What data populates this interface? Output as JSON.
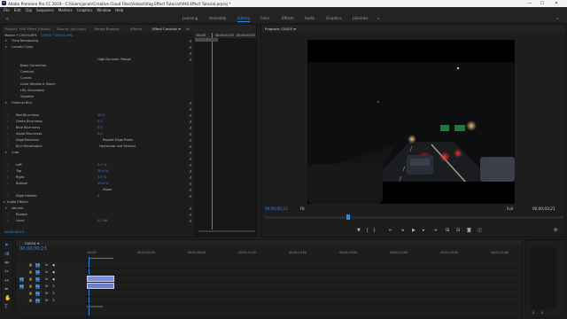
{
  "app": {
    "title": "Adobe Premiere Pro CC 2019 - C:\\Users\\jonah\\Creative Cloud Files\\Videos\\Vlog Effect Tutorial\\VHS Effect Tutorial.prproj *",
    "logo_text": "Pr"
  },
  "window_controls": {
    "minimize": "—",
    "maximize": "☐",
    "close": "✕"
  },
  "menu": [
    "File",
    "Edit",
    "Clip",
    "Sequence",
    "Markers",
    "Graphics",
    "Window",
    "Help"
  ],
  "workspaces": [
    {
      "label": "Learning",
      "active": false
    },
    {
      "label": "Assembly",
      "active": false
    },
    {
      "label": "Editing",
      "active": true
    },
    {
      "label": "Color",
      "active": false
    },
    {
      "label": "Effects",
      "active": false
    },
    {
      "label": "Audio",
      "active": false
    },
    {
      "label": "Graphics",
      "active": false
    },
    {
      "label": "Libraries",
      "active": false
    }
  ],
  "left_panel": {
    "tabs": [
      "Project: VHS Effect Tutorial",
      "Source: (no clips)",
      "Media Browser",
      "Effects",
      "Effect Controls ≡",
      "≫"
    ],
    "master_label": "Master * C0024.MP4",
    "clip_label": "C0024 * C0024.MP4",
    "time_ruler": [
      ":00:00",
      "00:00:01:00",
      "00:00:02:00"
    ],
    "hdr_label": "High Dynamic Range",
    "edge_behavior_option": "Repeat Edge Pixels",
    "blur_dimensions_option": "Horizontal and Vertical",
    "zoom_label": "Zoom",
    "current_time": "00:00:00:23",
    "rows": [
      {
        "label": "Time Remapping",
        "value": "",
        "indent": 1
      },
      {
        "label": "Lumetri Color",
        "value": "",
        "indent": 1
      },
      {
        "label": "",
        "value": "",
        "indent": 2
      },
      {
        "label": "",
        "value": "",
        "indent": 2
      },
      {
        "label": "Basic Correction",
        "value": "",
        "indent": 3
      },
      {
        "label": "Creative",
        "value": "",
        "indent": 3
      },
      {
        "label": "Curves",
        "value": "",
        "indent": 3
      },
      {
        "label": "Color Wheels & Match",
        "value": "",
        "indent": 3
      },
      {
        "label": "HSL Secondary",
        "value": "",
        "indent": 3
      },
      {
        "label": "Vignette",
        "value": "",
        "indent": 3
      },
      {
        "label": "Channel Blur",
        "value": "",
        "indent": 1
      },
      {
        "label": "",
        "value": "",
        "indent": 2
      },
      {
        "label": "Red Blurriness",
        "value": "10.0",
        "indent": 2
      },
      {
        "label": "Green Blurriness",
        "value": "0.0",
        "indent": 2
      },
      {
        "label": "Blue Blurriness",
        "value": "0.0",
        "indent": 2
      },
      {
        "label": "Alpha Blurriness",
        "value": "0.0",
        "indent": 2
      },
      {
        "label": "Edge Behavior",
        "value": "",
        "indent": 2
      },
      {
        "label": "Blur Dimensions",
        "value": "",
        "indent": 2
      },
      {
        "label": "Crop",
        "value": "",
        "indent": 1
      },
      {
        "label": "",
        "value": "",
        "indent": 2
      },
      {
        "label": "Left",
        "value": "0.0 %",
        "indent": 2
      },
      {
        "label": "Top",
        "value": "10.0 %",
        "indent": 2
      },
      {
        "label": "Right",
        "value": "0.0 %",
        "indent": 2
      },
      {
        "label": "Bottom",
        "value": "10.0 %",
        "indent": 2
      },
      {
        "label": "",
        "value": "",
        "indent": 2
      },
      {
        "label": "Edge Feather",
        "value": "0",
        "indent": 2
      },
      {
        "label": "Audio Effects",
        "value": "",
        "indent": 0
      },
      {
        "label": "Volume",
        "value": "",
        "indent": 1
      },
      {
        "label": "Bypass",
        "value": "",
        "indent": 2
      },
      {
        "label": "Level",
        "value": "0.0 dB",
        "indent": 2
      }
    ]
  },
  "program": {
    "tab": "Program: C0024 ≡",
    "timecode": "00;00;00;23",
    "fit": "Fit",
    "quality": "Full",
    "duration": "00;00;03;21"
  },
  "timeline": {
    "tab": "C0024 ≡",
    "timecode": "00;00;00;23",
    "ruler": [
      ":00;00",
      "00;00;04;00",
      "00;00;08;00",
      "00;00;12;00",
      "00;00;16;00",
      "00;00;20;00",
      "00;00;24;00",
      "00;00;28;00",
      "00;00;32;00"
    ],
    "tracks": [
      {
        "name": "V3",
        "kind": "video"
      },
      {
        "name": "V2",
        "kind": "video"
      },
      {
        "name": "V1",
        "kind": "video"
      },
      {
        "name": "A1",
        "kind": "audio"
      },
      {
        "name": "A2",
        "kind": "audio"
      },
      {
        "name": "A3",
        "kind": "audio"
      }
    ],
    "source_v1": "V1",
    "source_a1": "A1"
  },
  "meters": {
    "labels": [
      "S",
      "S"
    ]
  },
  "colors": {
    "accent": "#2d8ceb",
    "clip": "#7c8fd6",
    "panel": "#1d1d1d"
  }
}
